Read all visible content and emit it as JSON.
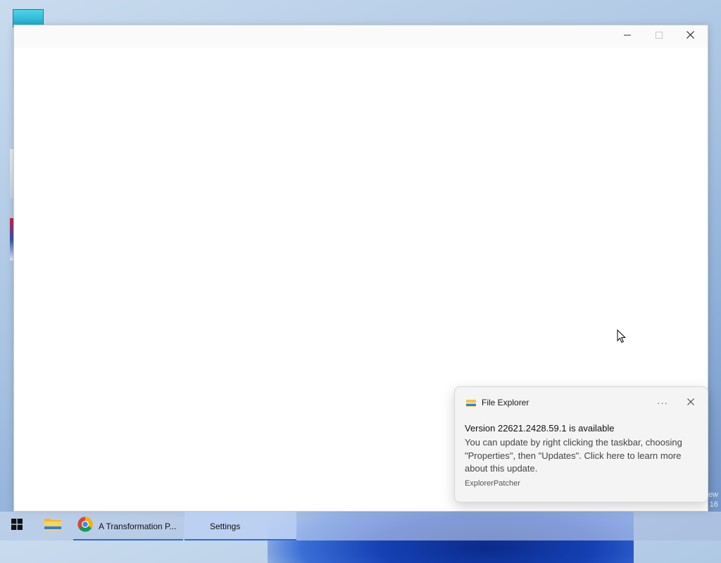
{
  "desktop": {
    "watermark_lines": [
      "ew",
      "16"
    ],
    "icons": [
      "desktop-icon-top",
      "recycle-bin-icon",
      "app-icon-1",
      "app-icon-2"
    ]
  },
  "window": {
    "controls": {
      "minimize": "minimize-icon",
      "maximize": "maximize-icon",
      "close": "close-icon"
    }
  },
  "taskbar": {
    "start_icon": "windows-start-icon",
    "items": [
      {
        "icon": "file-explorer-icon",
        "label": ""
      },
      {
        "icon": "chrome-icon",
        "label": "A Transformation P..."
      },
      {
        "icon": "",
        "label": "Settings"
      }
    ]
  },
  "toast": {
    "app_name": "File Explorer",
    "more_label": "···",
    "title": "Version 22621.2428.59.1 is available",
    "body": "You can update by right clicking the taskbar, choosing \"Properties\", then \"Updates\". Click here to learn more about this update.",
    "attribution": "ExplorerPatcher"
  },
  "colors": {
    "accent": "#2e6bd6",
    "toast_bg": "#f4f4f4",
    "window_bg": "#ffffff"
  }
}
